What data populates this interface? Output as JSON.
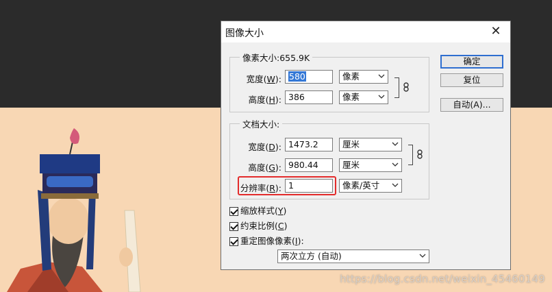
{
  "dialog": {
    "title": "图像大小",
    "close_glyph": "✕"
  },
  "pixel_dimensions": {
    "legend": "像素大小:655.9K",
    "width": {
      "label_pre": "宽度(",
      "mnemonic": "W",
      "label_post": "):",
      "value": "580",
      "unit": "像素"
    },
    "height": {
      "label_pre": "高度(",
      "mnemonic": "H",
      "label_post": "):",
      "value": "386",
      "unit": "像素"
    }
  },
  "document_size": {
    "legend": "文档大小:",
    "width": {
      "label_pre": "宽度(",
      "mnemonic": "D",
      "label_post": "):",
      "value": "1473.2",
      "unit": "厘米"
    },
    "height": {
      "label_pre": "高度(",
      "mnemonic": "G",
      "label_post": "):",
      "value": "980.44",
      "unit": "厘米"
    },
    "resolution": {
      "label_pre": "分辨率(",
      "mnemonic": "R",
      "label_post": "):",
      "value": "1",
      "unit": "像素/英寸"
    }
  },
  "buttons": {
    "ok": "确定",
    "reset": "复位",
    "auto": "自动(A)..."
  },
  "options": {
    "scale_styles": {
      "label_pre": "缩放样式(",
      "mnemonic": "Y",
      "label_post": ")",
      "checked": true
    },
    "constrain": {
      "label_pre": "约束比例(",
      "mnemonic": "C",
      "label_post": ")",
      "checked": true
    },
    "resample": {
      "label_pre": "重定图像像素(",
      "mnemonic": "I",
      "label_post": "):",
      "checked": true
    },
    "resample_method": "两次立方 (自动)"
  },
  "watermark": "https://blog.csdn.net/weixin_45460149",
  "colors": {
    "highlight": "#e32b2b",
    "selection": "#3478d6",
    "background_dark": "#2b2b2b",
    "painting_bg": "#f8d7b4"
  },
  "icons": [
    "close-icon",
    "chain-link-icon",
    "chevron-down-icon",
    "checkmark-icon"
  ]
}
